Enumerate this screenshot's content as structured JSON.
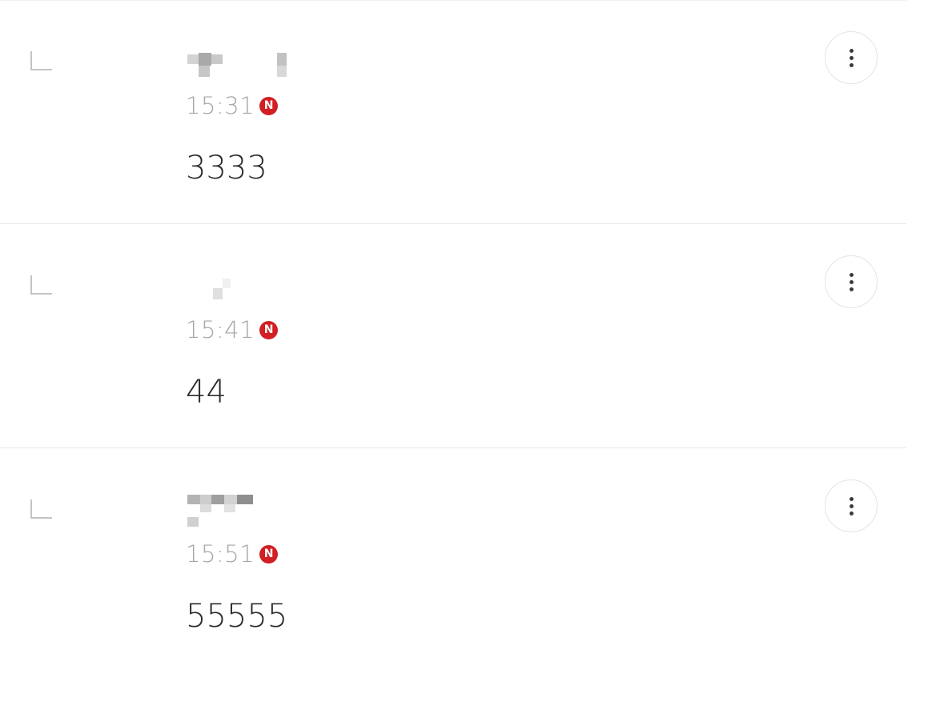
{
  "comments": [
    {
      "time": "15:31",
      "badge": "N",
      "text": "3333"
    },
    {
      "time": "15:41",
      "badge": "N",
      "text": "44"
    },
    {
      "time": "15:51",
      "badge": "N",
      "text": "55555"
    }
  ],
  "colors": {
    "badge": "#d11f24",
    "time": "#a6a6a6",
    "text": "#2b2b2b",
    "divider": "#e9e9e9"
  },
  "icons": {
    "reply": "reply-corner-icon",
    "badge": "n-badge-icon",
    "more": "more-vertical-icon"
  }
}
